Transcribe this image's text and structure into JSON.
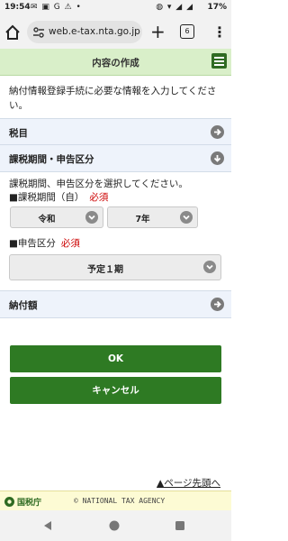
{
  "status_bar": {
    "time": "19:54",
    "battery": "17%"
  },
  "browser": {
    "url": "web.e-tax.nta.go.jp",
    "tab_count": "6"
  },
  "header": {
    "title": "内容の作成"
  },
  "intro_text": "納付情報登録手続に必要な情報を入力してください。",
  "sections": {
    "tax_item": "税目",
    "period": "課税期間・申告区分",
    "amount": "納付額"
  },
  "period_form": {
    "description": "課税期間、申告区分を選択してください。",
    "period_label": "■課税期間（自）",
    "required": "必須",
    "era_value": "令和",
    "year_value": "7年",
    "category_label": "■申告区分",
    "category_value": "予定１期"
  },
  "buttons": {
    "ok": "OK",
    "cancel": "キャンセル"
  },
  "page_top": "▲ページ先頭へ",
  "footer": {
    "agency": "国税庁",
    "copyright": "© NATIONAL TAX AGENCY"
  },
  "colors": {
    "accent_green": "#2e7a23",
    "header_bg": "#d9efc9",
    "section_bg": "#eef3fb",
    "required_red": "#cc0000"
  }
}
